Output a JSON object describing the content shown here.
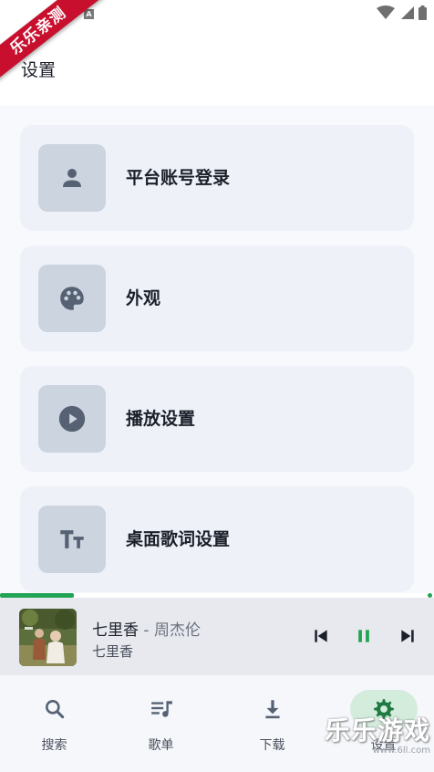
{
  "status_bar": {
    "indicator": "A"
  },
  "watermark": {
    "ribbon_text": "乐乐亲测",
    "corner_text": "乐乐游戏",
    "corner_url": "www.6ll.com"
  },
  "header": {
    "title": "设置"
  },
  "settings": [
    {
      "label": "平台账号登录",
      "icon": "person-icon"
    },
    {
      "label": "外观",
      "icon": "palette-icon"
    },
    {
      "label": "播放设置",
      "icon": "play-circle-icon"
    },
    {
      "label": "桌面歌词设置",
      "icon": "text-size-icon"
    }
  ],
  "player": {
    "title": "七里香",
    "separator": " - ",
    "artist": "周杰伦",
    "album": "七里香",
    "progress": 0.17,
    "accent_color": "#21a453"
  },
  "nav": [
    {
      "label": "搜索",
      "icon": "search-icon",
      "active": false
    },
    {
      "label": "歌单",
      "icon": "playlist-icon",
      "active": false
    },
    {
      "label": "下载",
      "icon": "download-icon",
      "active": false
    },
    {
      "label": "设置",
      "icon": "settings-icon",
      "active": true
    }
  ]
}
